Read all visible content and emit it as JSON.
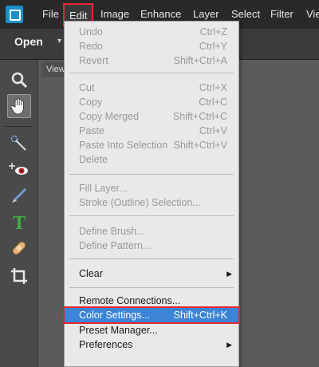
{
  "menubar": {
    "items": [
      {
        "label": "File"
      },
      {
        "label": "Edit"
      },
      {
        "label": "Image"
      },
      {
        "label": "Enhance"
      },
      {
        "label": "Layer"
      },
      {
        "label": "Select"
      },
      {
        "label": "Filter"
      },
      {
        "label": "Vie"
      }
    ]
  },
  "toolbar": {
    "open_label": "Open",
    "open_caret": "▾"
  },
  "document_tab": {
    "label": "View"
  },
  "tools": [
    {
      "name": "zoom-tool",
      "icon": "magnifier-icon"
    },
    {
      "name": "hand-tool",
      "icon": "hand-icon"
    },
    {
      "name": "quick-selection-tool",
      "icon": "magic-wand-icon"
    },
    {
      "name": "red-eye-tool",
      "icon": "red-eye-icon"
    },
    {
      "name": "brush-tool",
      "icon": "brush-icon"
    },
    {
      "name": "text-tool",
      "icon": "text-icon"
    },
    {
      "name": "healing-tool",
      "icon": "bandage-icon"
    },
    {
      "name": "crop-tool",
      "icon": "crop-icon"
    }
  ],
  "edit_menu": {
    "items": [
      {
        "label": "Undo",
        "shortcut": "Ctrl+Z"
      },
      {
        "label": "Redo",
        "shortcut": "Ctrl+Y"
      },
      {
        "label": "Revert",
        "shortcut": "Shift+Ctrl+A"
      },
      {
        "label": "Cut",
        "shortcut": "Ctrl+X"
      },
      {
        "label": "Copy",
        "shortcut": "Ctrl+C"
      },
      {
        "label": "Copy Merged",
        "shortcut": "Shift+Ctrl+C"
      },
      {
        "label": "Paste",
        "shortcut": "Ctrl+V"
      },
      {
        "label": "Paste Into Selection",
        "shortcut": "Shift+Ctrl+V"
      },
      {
        "label": "Delete",
        "shortcut": ""
      },
      {
        "label": "Fill Layer...",
        "shortcut": ""
      },
      {
        "label": "Stroke (Outline) Selection...",
        "shortcut": ""
      },
      {
        "label": "Define Brush...",
        "shortcut": ""
      },
      {
        "label": "Define Pattern...",
        "shortcut": ""
      },
      {
        "label": "Clear",
        "shortcut": ""
      },
      {
        "label": "Remote Connections...",
        "shortcut": ""
      },
      {
        "label": "Color Settings...",
        "shortcut": "Shift+Ctrl+K"
      },
      {
        "label": "Preset Manager...",
        "shortcut": ""
      },
      {
        "label": "Preferences",
        "shortcut": ""
      }
    ],
    "submenu_arrow": "▶"
  },
  "colors": {
    "highlight": "#3c84d6",
    "callout": "#e8262e",
    "disabled": "#999999"
  }
}
